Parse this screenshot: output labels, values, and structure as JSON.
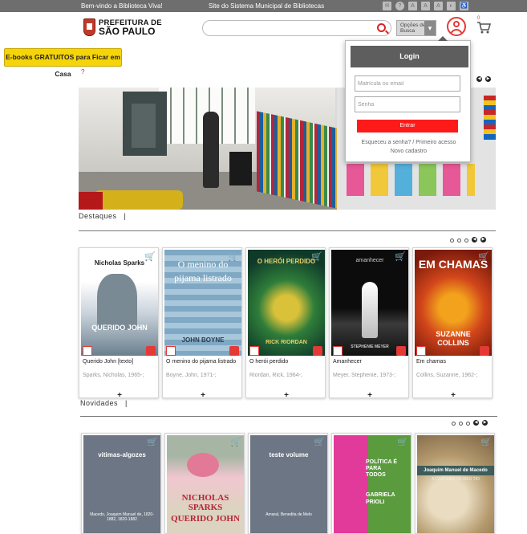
{
  "topbar": {
    "welcome": "Bem-vindo a Biblioteca Viva!",
    "site": "Site do Sistema Municipal de Bibliotecas",
    "icons": [
      "mail-icon",
      "help-icon",
      "font-decrease-icon",
      "font-default-icon",
      "font-increase-icon",
      "contrast-icon",
      "accessibility-icon"
    ]
  },
  "header": {
    "logo_line1": "PREFEITURA DE",
    "logo_line2": "SÃO PAULO",
    "search_placeholder": "",
    "options_line1": "Opções de",
    "options_line2": "Busca",
    "cart_count": "0"
  },
  "ebooks_button": "E-books GRATUITOS para Ficar em Casa",
  "red_mark": "?",
  "login": {
    "title": "Login",
    "user_placeholder": "Matrícula ou email",
    "password_placeholder": "Senha",
    "submit": "Entrar",
    "forgot": "Esqueceu a senha? / Primeiro acesso",
    "new_account": "Novo cadastro"
  },
  "destaques": {
    "title": "Destaques",
    "separator": "|",
    "items": [
      {
        "title": "Querido John [texto]",
        "author": "Sparks, Nicholas, 1965-;",
        "cover_top": "Nicholas Sparks",
        "cover_bottom": "QUERIDO JOHN"
      },
      {
        "title": "O menino do pijama listrado",
        "author": "Boyne, John, 1971-;",
        "cover_top": "O menino do pijama listrado",
        "cover_bottom": "JOHN BOYNE"
      },
      {
        "title": "O herói perdido",
        "author": "Riordan, Rick, 1964-;",
        "cover_top": "O HERÓI PERDIDO",
        "cover_bottom": "RICK RIORDAN"
      },
      {
        "title": "Amanhecer",
        "author": "Meyer, Stephenie, 1973-;",
        "cover_top": "amanhecer",
        "cover_bottom": "STEPHENIE MEYER"
      },
      {
        "title": "Em chamas",
        "author": "Collins, Suzanne, 1962-;",
        "cover_top": "EM CHAMAS",
        "cover_bottom": "SUZANNE COLLINS"
      }
    ]
  },
  "novidades": {
    "title": "Novidades",
    "separator": "|",
    "items": [
      {
        "cover_top": "vitimas-algozes",
        "cover_bottom": "Macedo, Joaquim Manuel de, 1820-1882, 1820-1882"
      },
      {
        "cover_top": "NICHOLAS SPARKS",
        "cover_bottom": "QUERIDO JOHN"
      },
      {
        "cover_top": "teste volume",
        "cover_bottom": "Amaral, Benedita de Melo"
      },
      {
        "cover_top": "POLÍTICA É PARA TODOS",
        "cover_bottom": "GABRIELA PRIOLI"
      },
      {
        "cover_top": "Joaquim Manuel de Macedo",
        "cover_bottom": "A CARTEIRA DE MEU TIO"
      }
    ]
  },
  "colors": {
    "accent_red": "#e53935",
    "topbar": "#6e6e6e",
    "ebooks_yellow": "#f5d50a"
  }
}
